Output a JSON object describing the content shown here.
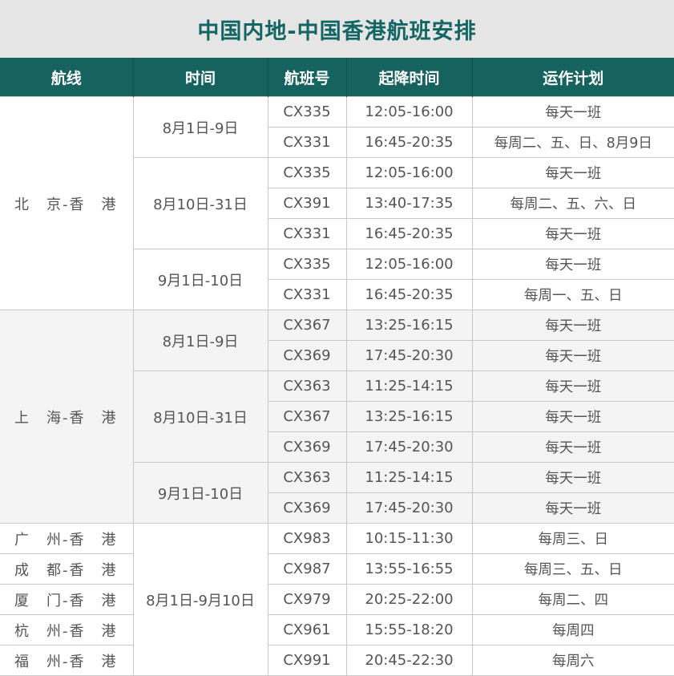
{
  "title": "中国内地-中国香港航班安排",
  "headers": [
    "航线",
    "时间",
    "航班号",
    "起降时间",
    "运作计划"
  ],
  "groups": [
    {
      "route": "北　京-香　港",
      "shade": false,
      "periods": [
        {
          "period": "8月1日-9日",
          "flights": [
            {
              "flight": "CX335",
              "time": "12:05-16:00",
              "plan": "每天一班"
            },
            {
              "flight": "CX331",
              "time": "16:45-20:35",
              "plan": "每周二、五、日、8月9日"
            }
          ]
        },
        {
          "period": "8月10日-31日",
          "flights": [
            {
              "flight": "CX335",
              "time": "12:05-16:00",
              "plan": "每天一班"
            },
            {
              "flight": "CX391",
              "time": "13:40-17:35",
              "plan": "每周二、五、六、日"
            },
            {
              "flight": "CX331",
              "time": "16:45-20:35",
              "plan": "每天一班"
            }
          ]
        },
        {
          "period": "9月1日-10日",
          "flights": [
            {
              "flight": "CX335",
              "time": "12:05-16:00",
              "plan": "每天一班"
            },
            {
              "flight": "CX331",
              "time": "16:45-20:35",
              "plan": "每周一、五、日"
            }
          ]
        }
      ]
    },
    {
      "route": "上　海-香　港",
      "shade": true,
      "periods": [
        {
          "period": "8月1日-9日",
          "flights": [
            {
              "flight": "CX367",
              "time": "13:25-16:15",
              "plan": "每天一班"
            },
            {
              "flight": "CX369",
              "time": "17:45-20:30",
              "plan": "每天一班"
            }
          ]
        },
        {
          "period": "8月10日-31日",
          "flights": [
            {
              "flight": "CX363",
              "time": "11:25-14:15",
              "plan": "每天一班"
            },
            {
              "flight": "CX367",
              "time": "13:25-16:15",
              "plan": "每天一班"
            },
            {
              "flight": "CX369",
              "time": "17:45-20:30",
              "plan": "每天一班"
            }
          ]
        },
        {
          "period": "9月1日-10日",
          "flights": [
            {
              "flight": "CX363",
              "time": "11:25-14:15",
              "plan": "每天一班"
            },
            {
              "flight": "CX369",
              "time": "17:45-20:30",
              "plan": "每天一班"
            }
          ]
        }
      ]
    }
  ],
  "single_period": "8月1日-9月10日",
  "single_routes": [
    {
      "route": "广　州-香　港",
      "flight": "CX983",
      "time": "10:15-11:30",
      "plan": "每周三、日"
    },
    {
      "route": "成　都-香　港",
      "flight": "CX987",
      "time": "13:55-16:55",
      "plan": "每周三、五、日"
    },
    {
      "route": "厦　门-香　港",
      "flight": "CX979",
      "time": "20:25-22:00",
      "plan": "每周二、四"
    },
    {
      "route": "杭　州-香　港",
      "flight": "CX961",
      "time": "15:55-18:20",
      "plan": "每周四"
    },
    {
      "route": "福　州-香　港",
      "flight": "CX991",
      "time": "20:45-22:30",
      "plan": "每周六"
    }
  ]
}
